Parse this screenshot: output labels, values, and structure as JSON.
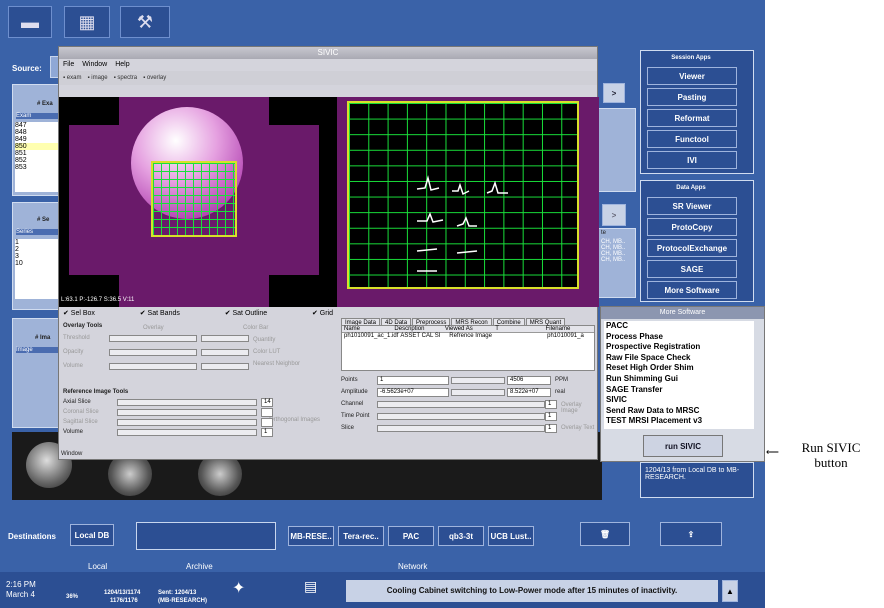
{
  "toolbar": {
    "icons": [
      "scanner-icon",
      "images-icon",
      "tools-icon"
    ]
  },
  "source": {
    "label": "Source:"
  },
  "exam": {
    "header": "# Exa",
    "col": "Exam",
    "rows": [
      "847",
      "848",
      "849",
      "850",
      "851",
      "852",
      "853"
    ]
  },
  "series": {
    "header": "# Se",
    "col": "Series",
    "rows": [
      "1",
      "2",
      "3",
      "10"
    ]
  },
  "image": {
    "header": "# Ima",
    "col": "Image"
  },
  "sivic": {
    "title": "SIVIC",
    "menus": [
      "File",
      "Window",
      "Help"
    ],
    "toolbar_items": [
      "exam",
      "image",
      "spectra",
      "overlay"
    ],
    "coords": "L:63.1   P:-126.7 S:36.5   V:11",
    "checkboxes": [
      "Sel Box",
      "Sat Bands",
      "Sat Outline",
      "Grid"
    ],
    "overlay_tools": "Overlay Tools",
    "overlay_labels": [
      "Threshold",
      "Opacity",
      "Volume"
    ],
    "overlay_opts": [
      "Overlay",
      "Color Bar",
      "Quantity",
      "Color LUT",
      "Nearest Neighbor"
    ],
    "ref_tools": "Reference Image Tools",
    "ref_labels": [
      "Axial Slice",
      "Coronal Slice",
      "Sagittal Slice",
      "Volume"
    ],
    "ref_values": [
      "14",
      "",
      "",
      "1"
    ],
    "ortho": "Orthogonal Images",
    "tabs": [
      "Image Data",
      "4D Data",
      "Preprocess",
      "MRS Recon",
      "Combine",
      "MRS Quant"
    ],
    "table_cols": [
      "Name",
      "Description",
      "Viewed As",
      "T",
      "Filename"
    ],
    "table_row": [
      "ph1010091_ac_1.idf",
      "ASSET CAL SI",
      "Refrence Image",
      "",
      "ph1010091_a"
    ],
    "spec_labels": [
      "Points",
      "Amplitude",
      "Channel",
      "Time Point",
      "Slice"
    ],
    "spec_left": [
      "1",
      "-6.5623e+07",
      "",
      "",
      ""
    ],
    "spec_right": [
      "4506",
      "8.522e+07",
      "1",
      "1",
      "1"
    ],
    "spec_opts": [
      "PPM",
      "real",
      "Overlay Image",
      "Overlay Text"
    ],
    "window": "Window"
  },
  "session_apps": {
    "title": "Session Apps",
    "items": [
      "Viewer",
      "Pasting",
      "Reformat",
      "Functool",
      "IVI"
    ]
  },
  "data_apps": {
    "title": "Data Apps",
    "items": [
      "SR Viewer",
      "ProtoCopy",
      "ProtocolExchange",
      "SAGE",
      "More Software"
    ]
  },
  "mid": {
    "col": "te",
    "rows": [
      "CH, MB..",
      "CH, MB..",
      "CH, MB..",
      "CH, MB.."
    ]
  },
  "more_software": {
    "title": "More Software",
    "items": [
      "PACC",
      "Process Phase",
      "Prospective Registration",
      "Raw File Space Check",
      "Reset High Order Shim",
      "Run Shimming Gui",
      "SAGE Transfer",
      "SIVIC",
      "Send Raw Data to MRSC",
      "TEST MRSI Placement v3"
    ],
    "run": "run SIVIC"
  },
  "log_text": "1204/13 from Local DB to MB-RESEARCH.",
  "annotation": {
    "line1": "Run SIVIC",
    "line2": "button"
  },
  "destinations": {
    "label": "Destinations",
    "local": "Local DB",
    "network": [
      "MB-RESE..",
      "Tera-rec..",
      "PAC",
      "qb3-3t",
      "UCB Lust.."
    ],
    "local_label": "Local",
    "archive_label": "Archive",
    "network_label": "Network"
  },
  "status": {
    "time": "2:16 PM",
    "date": "March 4",
    "pct": "36%",
    "job1a": "1204/13/1174",
    "job1b": "1176/1176",
    "job2a": "Sent: 1204/13",
    "job2b": "(MB-RESEARCH)",
    "message": "Cooling Cabinet switching to Low-Power mode after 15 minutes of inactivity."
  },
  "colors": {
    "desktop": "#3a62a8",
    "accent": "#2c4f93",
    "grid": "#19e03a",
    "select_box": "#d8e02a"
  }
}
